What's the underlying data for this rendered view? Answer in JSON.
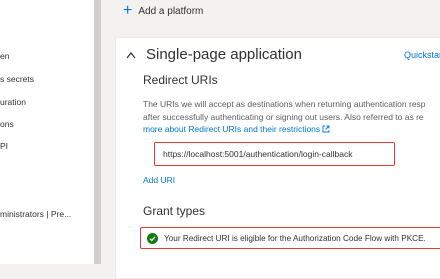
{
  "sidebar": {
    "items": [
      {
        "label": "en"
      },
      {
        "label": "s secrets"
      },
      {
        "label": "uration"
      },
      {
        "label": "ons"
      },
      {
        "label": "PI"
      },
      {
        "label": "ministrators | Pre..."
      }
    ]
  },
  "main": {
    "add_platform_label": "Add a platform",
    "card": {
      "title": "Single-page application",
      "quickstart_label": "Quickstart",
      "redirect_title": "Redirect URIs",
      "desc_line1": "The URIs we will accept as destinations when returning authentication resp",
      "desc_line2": "after successfully authenticating or signing out users. Also referred to as re",
      "desc_link": "more about Redirect URIs and their restrictions",
      "uri_value": "https://localhost:5001/authentication/login-callback",
      "add_uri_label": "Add URI",
      "grant_title": "Grant types",
      "grant_message": "Your Redirect URI is eligible for the Authorization Code Flow with PKCE."
    }
  },
  "colors": {
    "accent": "#0078d4",
    "highlight_border": "#e53935",
    "success": "#107c10"
  }
}
